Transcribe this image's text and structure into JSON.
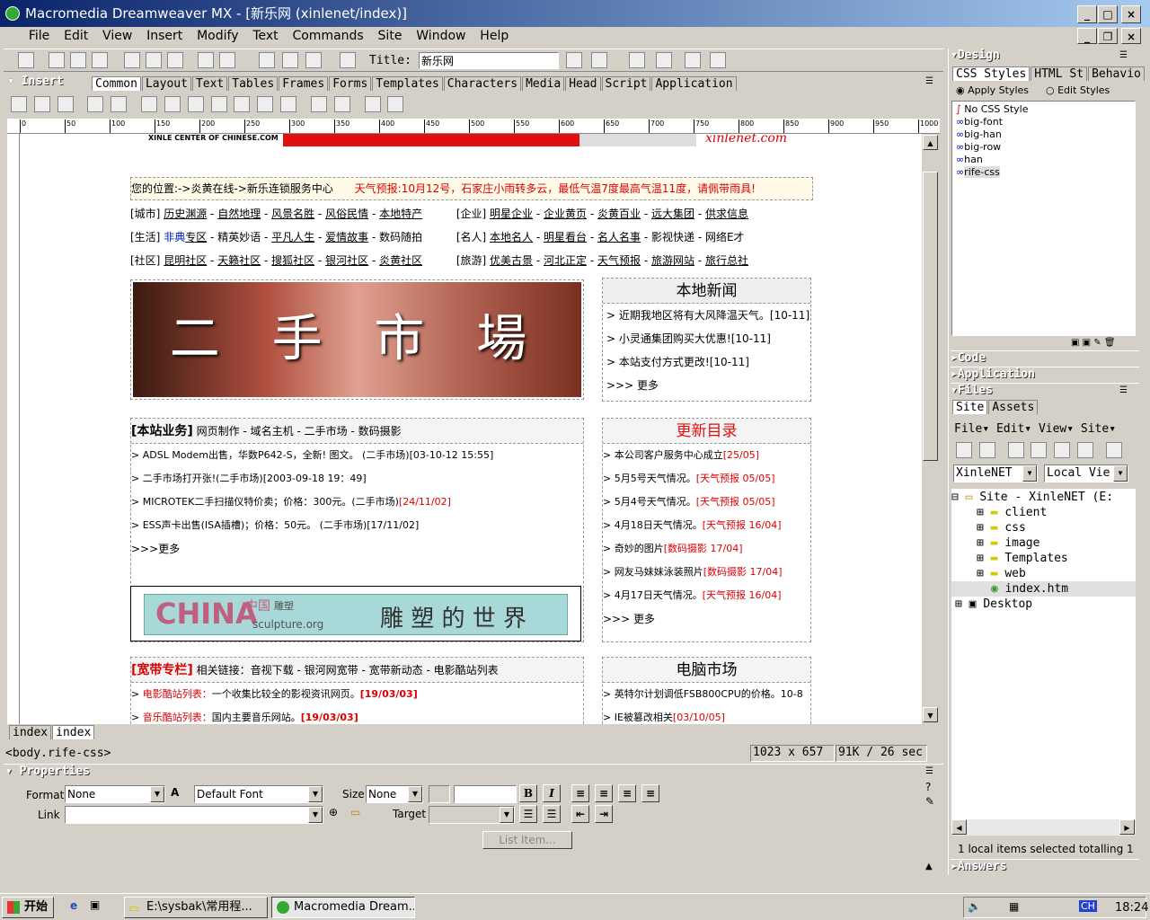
{
  "window": {
    "title": "Macromedia Dreamweaver MX - [新乐网 (xinlenet/index)]"
  },
  "menu": [
    "File",
    "Edit",
    "View",
    "Insert",
    "Modify",
    "Text",
    "Commands",
    "Site",
    "Window",
    "Help"
  ],
  "toolbar": {
    "title_label": "Title:",
    "title_value": "新乐网"
  },
  "insert": {
    "label": "Insert",
    "tabs": [
      "Common",
      "Layout",
      "Text",
      "Tables",
      "Frames",
      "Forms",
      "Templates",
      "Characters",
      "Media",
      "Head",
      "Script",
      "Application"
    ]
  },
  "ruler": [
    "0",
    "50",
    "100",
    "150",
    "200",
    "250",
    "300",
    "350",
    "400",
    "450",
    "500",
    "550",
    "600",
    "650",
    "700",
    "750",
    "800",
    "850",
    "900",
    "950",
    "1000"
  ],
  "doc": {
    "logo_text": "XINLE CENTER OF CHINESE.COM",
    "brand": "xinlenet.com",
    "location": "您的位置:->",
    "loc_link": "炎黄在线",
    "loc_rest": "->新乐连锁服务中心",
    "weather": "天气预报:10月12号，石家庄小雨转多云，最低气温7度最高气温11度，请佩带雨具!",
    "nav_rows": [
      {
        "cat": "[城市]",
        "links": [
          "历史渊源",
          "自然地理",
          "风景名胜",
          "风俗民情",
          "本地特产"
        ],
        "cat2": "[企业]",
        "links2": [
          "明星企业",
          "企业黄页",
          "炎黄百业",
          "远大集团",
          "供求信息"
        ]
      },
      {
        "cat": "[生活]",
        "pre": "非典",
        "links": [
          "专区",
          "精英妙语",
          "平凡人生",
          "爱情故事",
          "数码随拍"
        ],
        "cat2": "[名人]",
        "links2": [
          "本地名人",
          "明星看台",
          "名人名事",
          "影视快递",
          "网络E才"
        ]
      },
      {
        "cat": "[社区]",
        "links": [
          "昆明社区",
          "天籁社区",
          "搜狐社区",
          "银河社区",
          "炎黄社区"
        ],
        "cat2": "[旅游]",
        "links2": [
          "优美古景",
          "河北正定",
          "天气预报",
          "旅游网站",
          "旅行总社"
        ]
      }
    ],
    "banner_text": "二 手 市 場",
    "local_news_title": "本地新闻",
    "local_news": [
      {
        "text": "近期我地区将有大风降温天气。",
        "date": "[10-11]"
      },
      {
        "text": "小灵通集团购买大优惠!",
        "date": "[10-11]"
      },
      {
        "text": "本站支付方式更改!",
        "date": "[10-11]"
      }
    ],
    "more_prefix": ">>>",
    "more": "更多",
    "biz_title": "[本站业务]",
    "biz_links": [
      "网页制作",
      "域名主机",
      "二手市场",
      "数码摄影"
    ],
    "biz_items": [
      {
        "text": "ADSL Modem出售，华数P642-S，全新! 图文。",
        "tail": "(二手市场)[03-10-12 15:55]"
      },
      {
        "text": "二手市场打开张!",
        "tail": "(二手市场)[2003-09-18 19：49]"
      },
      {
        "text": "MICROTEK二手扫描仪特价卖；价格：300元。",
        "tail": "(二手市场)",
        "red": "[24/11/02]"
      },
      {
        "text": "ESS声卡出售(ISA插槽)；价格：50元。",
        "tail": "(二手市场)[17/11/02]"
      }
    ],
    "update_title": "更新目录",
    "updates": [
      {
        "text": "本公司客户服务中心成立",
        "red": "[25/05]"
      },
      {
        "text": "5月5号天气情况。",
        "red": "[天气预报 05/05]"
      },
      {
        "text": "5月4号天气情况。",
        "red": "[天气预报 05/05]"
      },
      {
        "text": "4月18日天气情况。",
        "red": "[天气预报 16/04]"
      },
      {
        "text": "奇妙的图片",
        "red": "[数码摄影 17/04]"
      },
      {
        "text": "网友马妹妹泳装照片",
        "red": "[数码摄影 17/04]"
      },
      {
        "text": "4月17日天气情况。",
        "red": "[天气预报 16/04]"
      }
    ],
    "china_ad": "CHINA",
    "china_ad_cn": "中国",
    "china_ad_sub": "sculpture.org",
    "china_ad_small": "雕塑",
    "china_ad_right": "雕 塑 的 世 界",
    "broad_title": "[宽带专栏]",
    "broad_related": "相关链接：",
    "broad_links": [
      "音视下载",
      "银河网宽带",
      "宽带新动态",
      "电影酷站列表"
    ],
    "broad_items": [
      {
        "label": "电影酷站列表：",
        "text": "一个收集比较全的影视资讯网页。",
        "date": "[19/03/03]"
      },
      {
        "label": "音乐酷站列表：",
        "text": "国内主要音乐网站。",
        "date": "[19/03/03]"
      }
    ],
    "pc_title": "电脑市场",
    "pc_items": [
      {
        "text": "英特尔计划调低FSB800CPU的价格。10-8",
        "red": ""
      },
      {
        "text": "IE被篡改相关",
        "red": "[03/10/05]"
      }
    ]
  },
  "doc_tabs": [
    "index",
    "index"
  ],
  "status": {
    "tag": "<body.rife-css>",
    "size": "1023 x 657",
    "speed": "91K / 26 sec"
  },
  "properties": {
    "title": "Properties",
    "format_label": "Format",
    "format_value": "None",
    "font_value": "Default Font",
    "size_label": "Size",
    "size_value": "None",
    "link_label": "Link",
    "target_label": "Target",
    "list_item": "List Item..."
  },
  "right": {
    "design": "Design",
    "design_tabs": [
      "CSS Styles",
      "HTML St",
      "Behavio"
    ],
    "apply": "Apply Styles",
    "edit": "Edit Styles",
    "styles": [
      "No CSS Style",
      "big-font",
      "big-han",
      "big-row",
      "han",
      "rife-css"
    ],
    "code": "Code",
    "application": "Application",
    "files": "Files",
    "files_tabs": [
      "Site",
      "Assets"
    ],
    "files_menu": [
      "File",
      "Edit",
      "View",
      "Site"
    ],
    "site_select": "XinleNET",
    "view_select": "Local Vie",
    "tree": [
      "Site - XinleNET (E:",
      "client",
      "css",
      "image",
      "Templates",
      "web",
      "index.htm",
      "Desktop"
    ],
    "status": "1 local items selected totalling 1",
    "answers": "Answers"
  },
  "taskbar": {
    "start": "开始",
    "task1": "E:\\sysbak\\常用程...",
    "task2": "Macromedia Dream...",
    "clock": "18:24",
    "ime": "CH"
  }
}
